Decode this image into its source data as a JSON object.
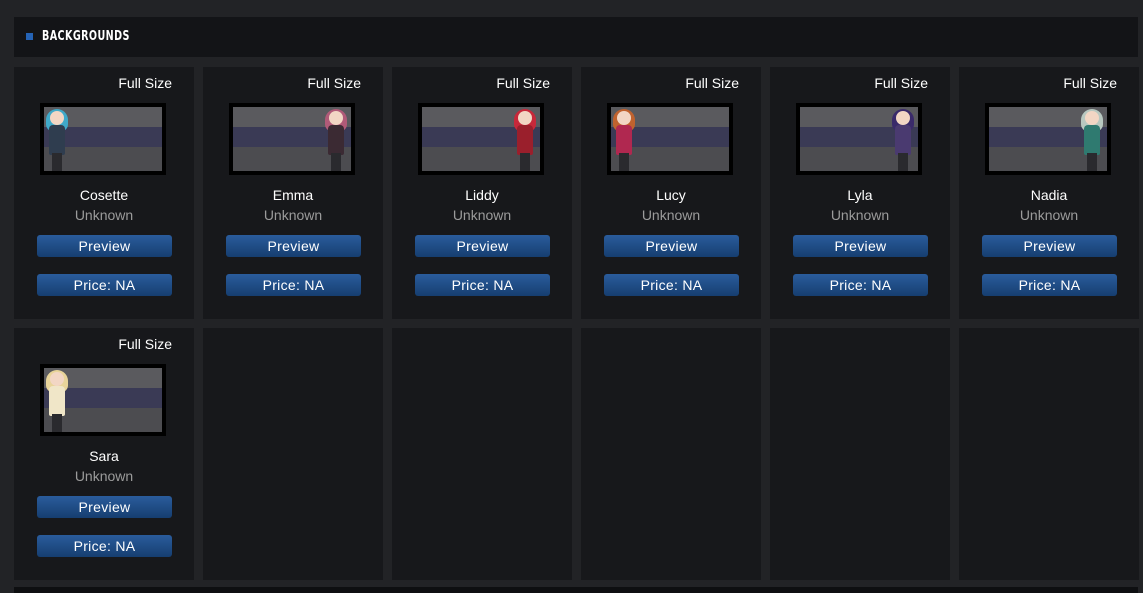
{
  "header": {
    "title": "BACKGROUNDS"
  },
  "cards": [
    {
      "full_size": "Full Size",
      "name": "Cosette",
      "status": "Unknown",
      "preview": "Preview",
      "price": "Price: NA",
      "char_side": "left",
      "hair": "#3fa9c9",
      "body": "#2f3d4f"
    },
    {
      "full_size": "Full Size",
      "name": "Emma",
      "status": "Unknown",
      "preview": "Preview",
      "price": "Price: NA",
      "char_side": "right",
      "hair": "#b05a78",
      "body": "#3b2a33"
    },
    {
      "full_size": "Full Size",
      "name": "Liddy",
      "status": "Unknown",
      "preview": "Preview",
      "price": "Price: NA",
      "char_side": "right",
      "hair": "#c8283a",
      "body": "#9a1f2c"
    },
    {
      "full_size": "Full Size",
      "name": "Lucy",
      "status": "Unknown",
      "preview": "Preview",
      "price": "Price: NA",
      "char_side": "left",
      "hair": "#c0622e",
      "body": "#b02850"
    },
    {
      "full_size": "Full Size",
      "name": "Lyla",
      "status": "Unknown",
      "preview": "Preview",
      "price": "Price: NA",
      "char_side": "right",
      "hair": "#3a2a6a",
      "body": "#4a3a70"
    },
    {
      "full_size": "Full Size",
      "name": "Nadia",
      "status": "Unknown",
      "preview": "Preview",
      "price": "Price: NA",
      "char_side": "right",
      "hair": "#b8c8c0",
      "body": "#2f7a70"
    },
    {
      "full_size": "Full Size",
      "name": "Sara",
      "status": "Unknown",
      "preview": "Preview",
      "price": "Price: NA",
      "char_side": "left",
      "hair": "#e8d49a",
      "body": "#f0e6c8"
    }
  ],
  "empty_slots": 5,
  "colors": {
    "accent": "#2563b5",
    "button_top": "#2a5c9c",
    "button_bottom": "#163e70",
    "card_bg": "#17181b",
    "page_bg": "#222326"
  }
}
